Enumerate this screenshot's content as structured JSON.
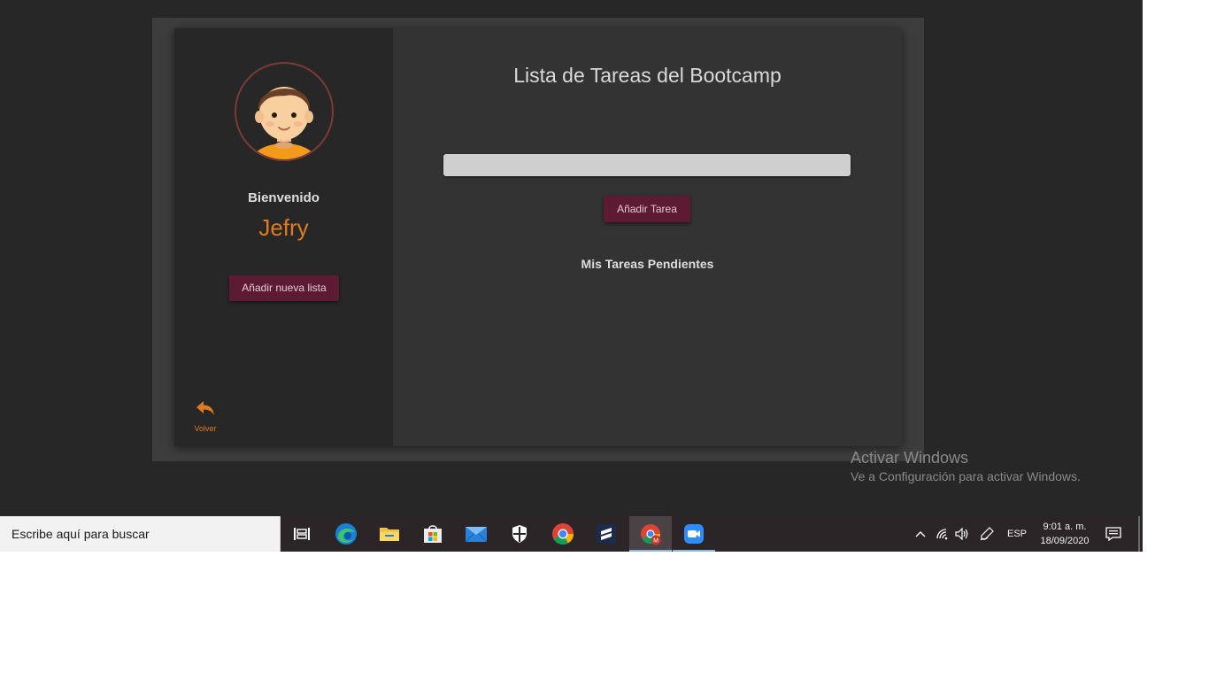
{
  "app": {
    "title": "Lista de Tareas del Bootcamp",
    "welcome_label": "Bienvenido",
    "username": "Jefry",
    "add_list_label": "Añadir nueva lista",
    "back_label": "Volver",
    "task_input_value": "",
    "add_task_label": "Añadir Tarea",
    "pending_title": "Mis Tareas Pendientes",
    "accent_color": "#e07a1f",
    "button_color": "#5c1a33"
  },
  "watermark": {
    "title": "Activar Windows",
    "subtitle": "Ve a Configuración para activar Windows."
  },
  "taskbar": {
    "search_placeholder": "Escribe aquí para buscar",
    "apps": [
      {
        "icon": "task-view-icon"
      },
      {
        "icon": "edge-icon"
      },
      {
        "icon": "file-explorer-icon"
      },
      {
        "icon": "store-icon"
      },
      {
        "icon": "mail-icon"
      },
      {
        "icon": "security-shield-icon"
      },
      {
        "icon": "chrome-icon"
      },
      {
        "icon": "sublime-text-icon"
      },
      {
        "icon": "chrome-profile-icon",
        "active": true
      },
      {
        "icon": "zoom-icon",
        "running": true
      }
    ],
    "tray": {
      "language": "ESP",
      "time": "9:01 a. m.",
      "date": "18/09/2020"
    }
  }
}
